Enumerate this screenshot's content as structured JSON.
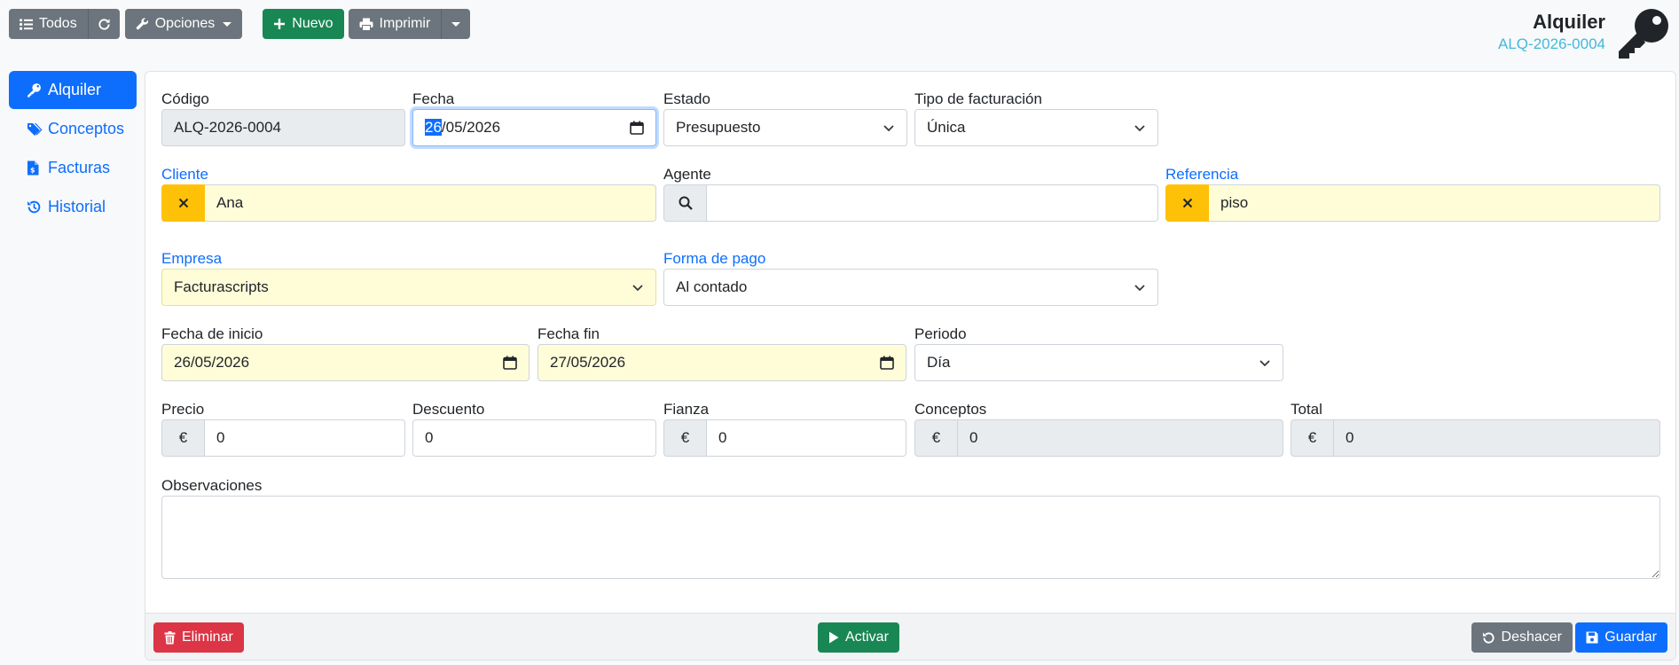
{
  "toolbar": {
    "all_label": "Todos",
    "options_label": "Opciones",
    "new_label": "Nuevo",
    "print_label": "Imprimir"
  },
  "header": {
    "title": "Alquiler",
    "code": "ALQ-2026-0004"
  },
  "sidebar": {
    "items": [
      {
        "label": "Alquiler",
        "icon": "key-icon",
        "active": true
      },
      {
        "label": "Conceptos",
        "icon": "tags-icon",
        "active": false
      },
      {
        "label": "Facturas",
        "icon": "invoice-icon",
        "active": false
      },
      {
        "label": "Historial",
        "icon": "history-icon",
        "active": false
      }
    ]
  },
  "form": {
    "codigo": {
      "label": "Código",
      "value": "ALQ-2026-0004"
    },
    "fecha": {
      "label": "Fecha",
      "value_selected": "26",
      "value_rest": "/05/2026"
    },
    "estado": {
      "label": "Estado",
      "value": "Presupuesto"
    },
    "tipo_facturacion": {
      "label": "Tipo de facturación",
      "value": "Única"
    },
    "cliente": {
      "label": "Cliente",
      "value": "Ana"
    },
    "agente": {
      "label": "Agente",
      "value": ""
    },
    "referencia": {
      "label": "Referencia",
      "value": "piso"
    },
    "empresa": {
      "label": "Empresa",
      "value": "Facturascripts"
    },
    "forma_pago": {
      "label": "Forma de pago",
      "value": "Al contado"
    },
    "fecha_inicio": {
      "label": "Fecha de inicio",
      "value": "26/05/2026"
    },
    "fecha_fin": {
      "label": "Fecha fin",
      "value": "27/05/2026"
    },
    "periodo": {
      "label": "Periodo",
      "value": "Día"
    },
    "precio": {
      "label": "Precio",
      "value": "0",
      "currency": "€"
    },
    "descuento": {
      "label": "Descuento",
      "value": "0"
    },
    "fianza": {
      "label": "Fianza",
      "value": "0",
      "currency": "€"
    },
    "conceptos": {
      "label": "Conceptos",
      "value": "0",
      "currency": "€"
    },
    "total": {
      "label": "Total",
      "value": "0",
      "currency": "€"
    },
    "observaciones": {
      "label": "Observaciones",
      "value": ""
    }
  },
  "footer": {
    "delete_label": "Eliminar",
    "activate_label": "Activar",
    "undo_label": "Deshacer",
    "save_label": "Guardar"
  },
  "colors": {
    "primary": "#0d6efd",
    "success": "#198754",
    "danger": "#dc3545",
    "secondary": "#6c757d",
    "warning": "#ffc107",
    "required_bg": "#fefdd8",
    "code_accent": "#3fb9dc"
  }
}
